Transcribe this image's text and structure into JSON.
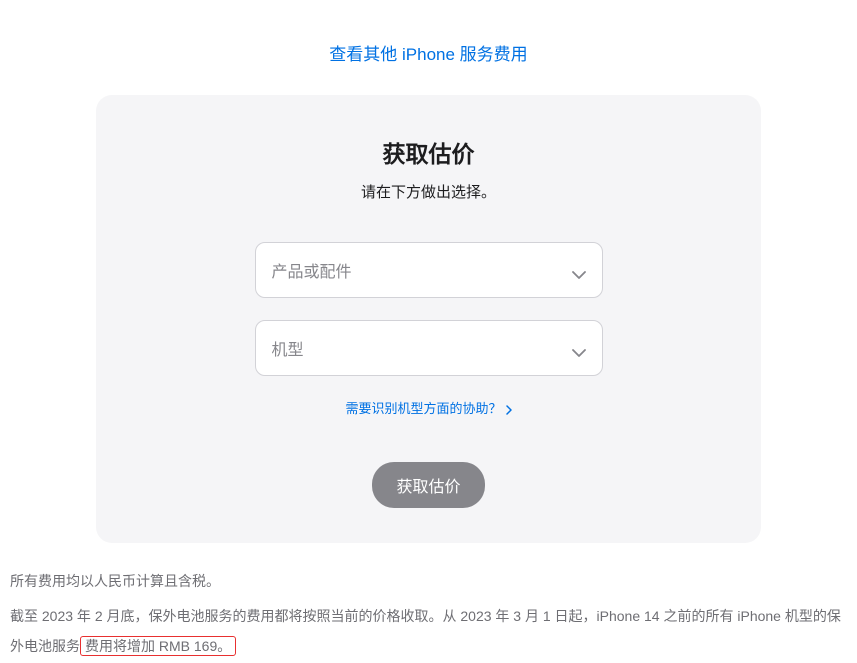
{
  "topLink": {
    "label": "查看其他 iPhone 服务费用"
  },
  "card": {
    "title": "获取估价",
    "subtitle": "请在下方做出选择。",
    "select1": {
      "placeholder": "产品或配件"
    },
    "select2": {
      "placeholder": "机型"
    },
    "helpLink": {
      "label": "需要识别机型方面的协助？"
    },
    "submitButton": {
      "label": "获取估价"
    }
  },
  "footer": {
    "line1": "所有费用均以人民币计算且含税。",
    "line2_part1": "截至 2023 年 2 月底，保外电池服务的费用都将按照当前的价格收取。从 2023 年 3 月 1 日起，iPhone 14 之前的所有 iPhone 机型的保外电池服务",
    "line2_highlight": "费用将增加 RMB 169。"
  }
}
